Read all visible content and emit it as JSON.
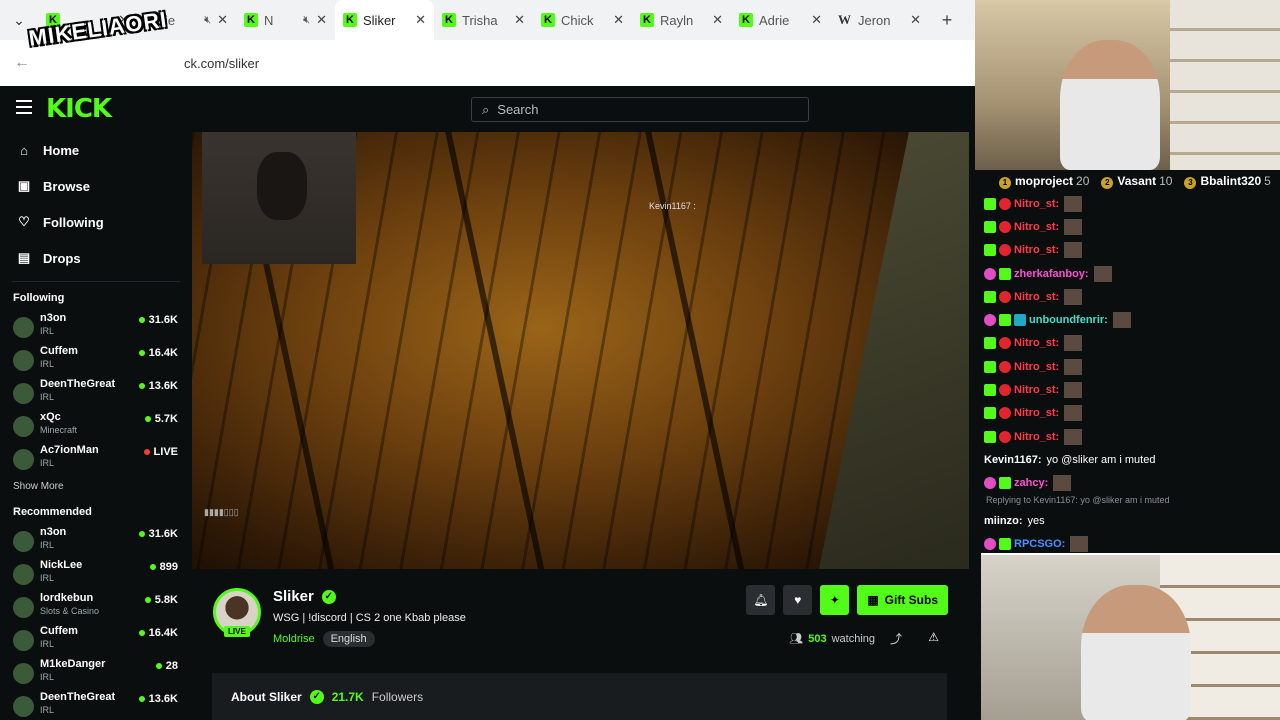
{
  "browser": {
    "tabs": [
      {
        "title": "",
        "favicon": "kick",
        "icon": "close"
      },
      {
        "title": "je",
        "favicon": "kick",
        "icon": "mute"
      },
      {
        "title": "N",
        "favicon": "kick",
        "icon": "mute"
      },
      {
        "title": "Sliker",
        "favicon": "kick",
        "icon": "close",
        "active": true
      },
      {
        "title": "Trisha",
        "favicon": "kick",
        "icon": "close"
      },
      {
        "title": "Chick",
        "favicon": "kick",
        "icon": "close"
      },
      {
        "title": "Rayln",
        "favicon": "kick",
        "icon": "close"
      },
      {
        "title": "Adrie",
        "favicon": "kick",
        "icon": "close"
      },
      {
        "title": "Jeron",
        "favicon": "wikipedia",
        "icon": "close"
      }
    ],
    "new_tab": "+",
    "url": "ck.com/sliker",
    "watermark": "MIKELIAORI"
  },
  "kick": {
    "logo": "KICK",
    "search_placeholder": "Search",
    "nav": [
      {
        "label": "Home",
        "icon": "home-icon"
      },
      {
        "label": "Browse",
        "icon": "browse-icon"
      },
      {
        "label": "Following",
        "icon": "heart-icon"
      },
      {
        "label": "Drops",
        "icon": "drops-icon"
      }
    ],
    "following_heading": "Following",
    "following": [
      {
        "name": "n3on",
        "category": "IRL",
        "viewers": "31.6K"
      },
      {
        "name": "Cuffem",
        "category": "IRL",
        "viewers": "16.4K"
      },
      {
        "name": "DeenTheGreat",
        "category": "IRL",
        "viewers": "13.6K"
      },
      {
        "name": "xQc",
        "category": "Minecraft",
        "viewers": "5.7K"
      },
      {
        "name": "Ac7ionMan",
        "category": "IRL",
        "viewers": "LIVE"
      }
    ],
    "show_more": "Show More",
    "recommended_heading": "Recommended",
    "recommended": [
      {
        "name": "n3on",
        "category": "IRL",
        "viewers": "31.6K"
      },
      {
        "name": "NickLee",
        "category": "IRL",
        "viewers": "899"
      },
      {
        "name": "lordkebun",
        "category": "Slots & Casino",
        "viewers": "5.8K"
      },
      {
        "name": "Cuffem",
        "category": "IRL",
        "viewers": "16.4K"
      },
      {
        "name": "M1keDanger",
        "category": "IRL",
        "viewers": "28"
      },
      {
        "name": "DeenTheGreat",
        "category": "IRL",
        "viewers": "13.6K"
      }
    ],
    "video_overlay_name": "Kevin1167 : ",
    "stream": {
      "name": "Sliker",
      "live_label": "LIVE",
      "title": "WSG | !discord | CS 2 one Kbab please",
      "category": "Moldrise",
      "language": "English",
      "gift_label": "Gift Subs",
      "watching_count": "503",
      "watching_label": "watching",
      "about_label": "About Sliker",
      "followers_count": "21.7K",
      "followers_label": "Followers"
    }
  },
  "right_panel": {
    "leaderboard": [
      {
        "rank": "1",
        "name": "moproject",
        "value": "20"
      },
      {
        "rank": "2",
        "name": "Vasant",
        "value": "10"
      },
      {
        "rank": "3",
        "name": "Bbalint320",
        "value": "5"
      }
    ],
    "chat": [
      {
        "user": "Nitro_st:",
        "color": "red"
      },
      {
        "user": "Nitro_st:",
        "color": "red"
      },
      {
        "user": "Nitro_st:",
        "color": "red"
      },
      {
        "user": "zherkafanboy:",
        "color": "pink",
        "badge": "24"
      },
      {
        "user": "Nitro_st:",
        "color": "red"
      },
      {
        "user": "unboundfenrir:",
        "color": "teal",
        "badge": "34"
      },
      {
        "user": "Nitro_st:",
        "color": "red"
      },
      {
        "user": "Nitro_st:",
        "color": "red"
      },
      {
        "user": "Nitro_st:",
        "color": "red"
      },
      {
        "user": "Nitro_st:",
        "color": "red"
      },
      {
        "user": "Nitro_st:",
        "color": "red"
      },
      {
        "user": "Kevin1167:",
        "color": "white",
        "message": "yo @sliker am i muted"
      },
      {
        "user": "zahcy:",
        "color": "pink",
        "badge": "26"
      }
    ],
    "reply_text": "Replying to Kevin1167: yo @sliker am i muted",
    "chat_after": [
      {
        "user": "miinzo:",
        "color": "white",
        "message": "yes"
      },
      {
        "user": "RPCSGO:",
        "color": "blue",
        "badge": "49"
      }
    ]
  },
  "colors": {
    "accent": "#53fc18",
    "bg": "#0b0e0f",
    "panel": "#191c1f"
  }
}
